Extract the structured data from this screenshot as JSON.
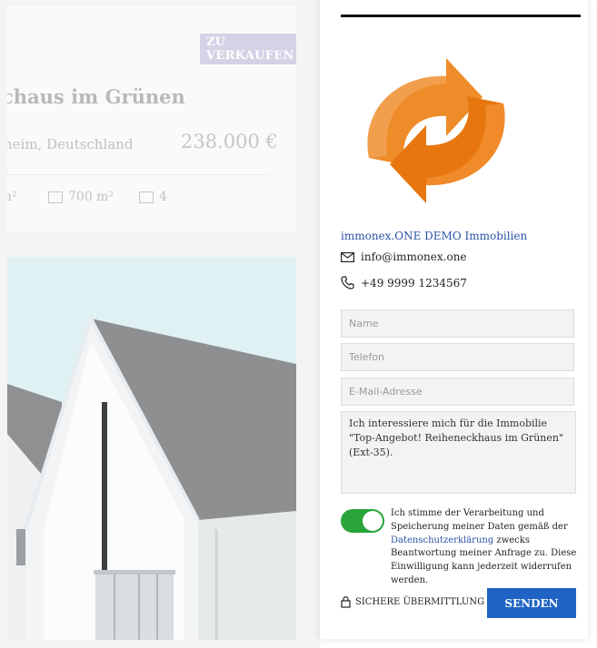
{
  "listing": {
    "status_badge": "ZU VERKAUFEN",
    "title": "chaus im Grünen",
    "location": "heim, Deutschland",
    "price": "238.000 €",
    "features": {
      "area_partial": "n²",
      "plot_area": "700 m²",
      "rooms": "4"
    }
  },
  "agent": {
    "agency_name": "immonex.ONE DEMO Immobilien",
    "email": "info@immonex.one",
    "phone": "+49 9999 1234567"
  },
  "form": {
    "name_placeholder": "Name",
    "phone_placeholder": "Telefon",
    "email_placeholder": "E-Mail-Adresse",
    "message_value": "Ich interessiere mich für die Immobilie \"Top-Angebot! Reiheneckhaus im Grünen\" (Ext-35).",
    "consent_toggle_on": true,
    "consent_text_before": "Ich stimme der Verarbeitung und Speicherung meiner Daten gemäß der ",
    "consent_link": "Datenschutzerklärung",
    "consent_text_after": " zwecks Beantwortung meiner Anfrage zu. Diese Einwilligung kann jederzeit widerrufen werden.",
    "secure_label": "SICHERE ÜBERMITTLUNG",
    "submit_label": "SENDEN"
  },
  "colors": {
    "accent_blue": "#1f63c4",
    "link_blue": "#2b53a6",
    "toggle_green": "#2aa53a",
    "logo_orange": "#ee8c2a"
  }
}
